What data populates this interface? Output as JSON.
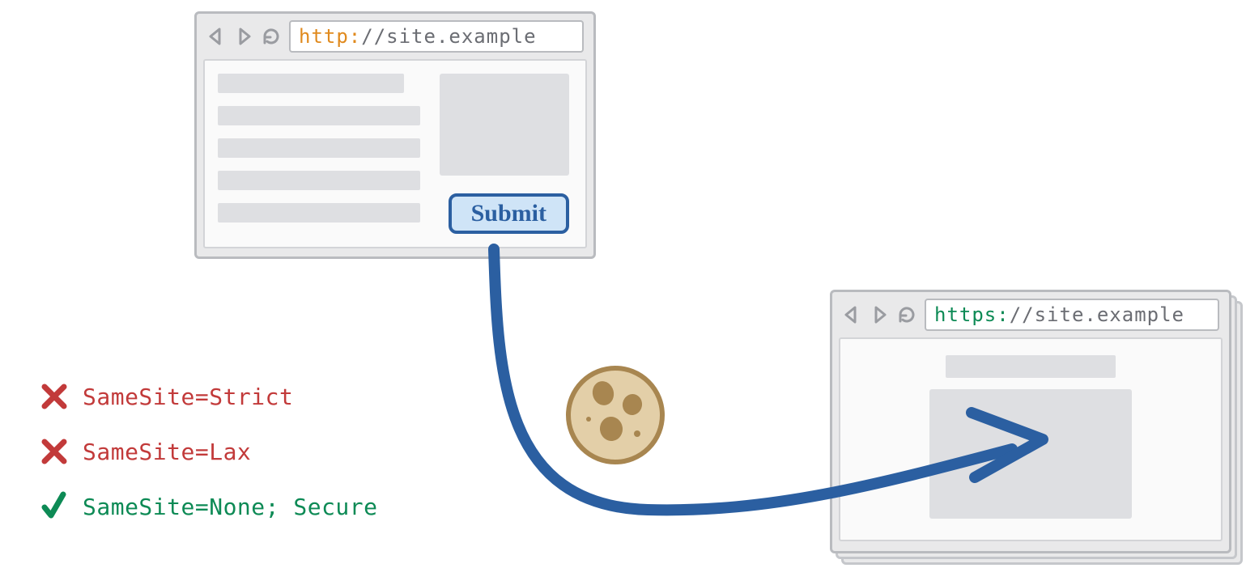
{
  "browser_source": {
    "url_scheme": "http:",
    "url_rest": "//site.example",
    "submit_label": "Submit"
  },
  "browser_target": {
    "url_scheme": "https:",
    "url_rest": "//site.example"
  },
  "legend": {
    "rows": [
      {
        "status": "blocked",
        "text": "SameSite=Strict"
      },
      {
        "status": "blocked",
        "text": "SameSite=Lax"
      },
      {
        "status": "allowed",
        "text": "SameSite=None; Secure"
      }
    ]
  },
  "colors": {
    "red": "#c23a3a",
    "green": "#0d8a55",
    "blue": "#2b5fa1",
    "orange": "#e08a1e",
    "gray": "#9a9ca1"
  }
}
